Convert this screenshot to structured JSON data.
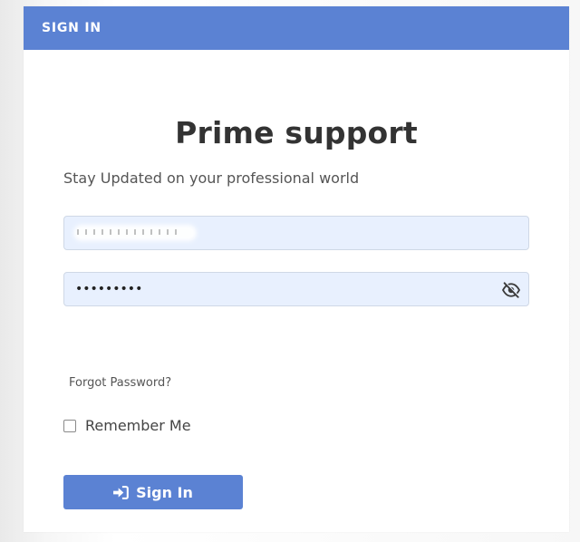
{
  "header": {
    "title": "SIGN IN"
  },
  "brand": {
    "title": "Prime support",
    "tagline": "Stay Updated on your professional world"
  },
  "form": {
    "username": {
      "value": "",
      "redacted": true
    },
    "password": {
      "value": "•••••••••",
      "toggle_icon": "eye-slash-icon"
    },
    "forgot_password_label": "Forgot Password?",
    "remember_me_label": "Remember Me",
    "remember_me_checked": false,
    "submit_label": "Sign In",
    "submit_icon": "sign-in-icon"
  },
  "colors": {
    "accent": "#5b82d3",
    "input_bg": "#e8f0fe",
    "text": "#333333"
  }
}
